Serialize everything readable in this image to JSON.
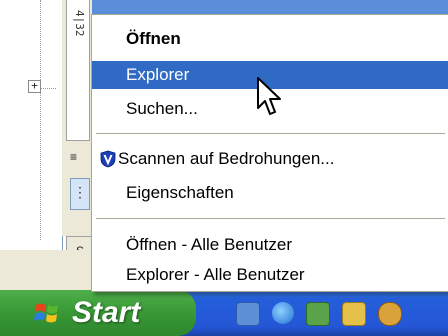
{
  "tree": {
    "expander_symbol": "+"
  },
  "ruler": {
    "label": "4|32"
  },
  "side_controls": {
    "menu_symbol": "≡",
    "grip_symbol": "⋮",
    "tab_label": "S"
  },
  "context_menu": {
    "open_label": "Öffnen",
    "explorer_label": "Explorer",
    "search_label": "Suchen...",
    "scan_label": "Scannen auf Bedrohungen...",
    "properties_label": "Eigenschaften",
    "open_all_label": "Öffnen - Alle Benutzer",
    "explorer_all_label": "Explorer - Alle Benutzer",
    "highlighted_item": "Explorer"
  },
  "taskbar": {
    "start_label": "Start",
    "quick_launch": [
      "desktop-icon",
      "internet-explorer-icon",
      "outlook-express-icon",
      "messenger-icon",
      "media-icon"
    ]
  },
  "colors": {
    "menu_highlight": "#316ac5",
    "taskbar_blue": "#245edb",
    "start_green": "#3c9c38",
    "shield_blue": "#1c3fb8"
  }
}
